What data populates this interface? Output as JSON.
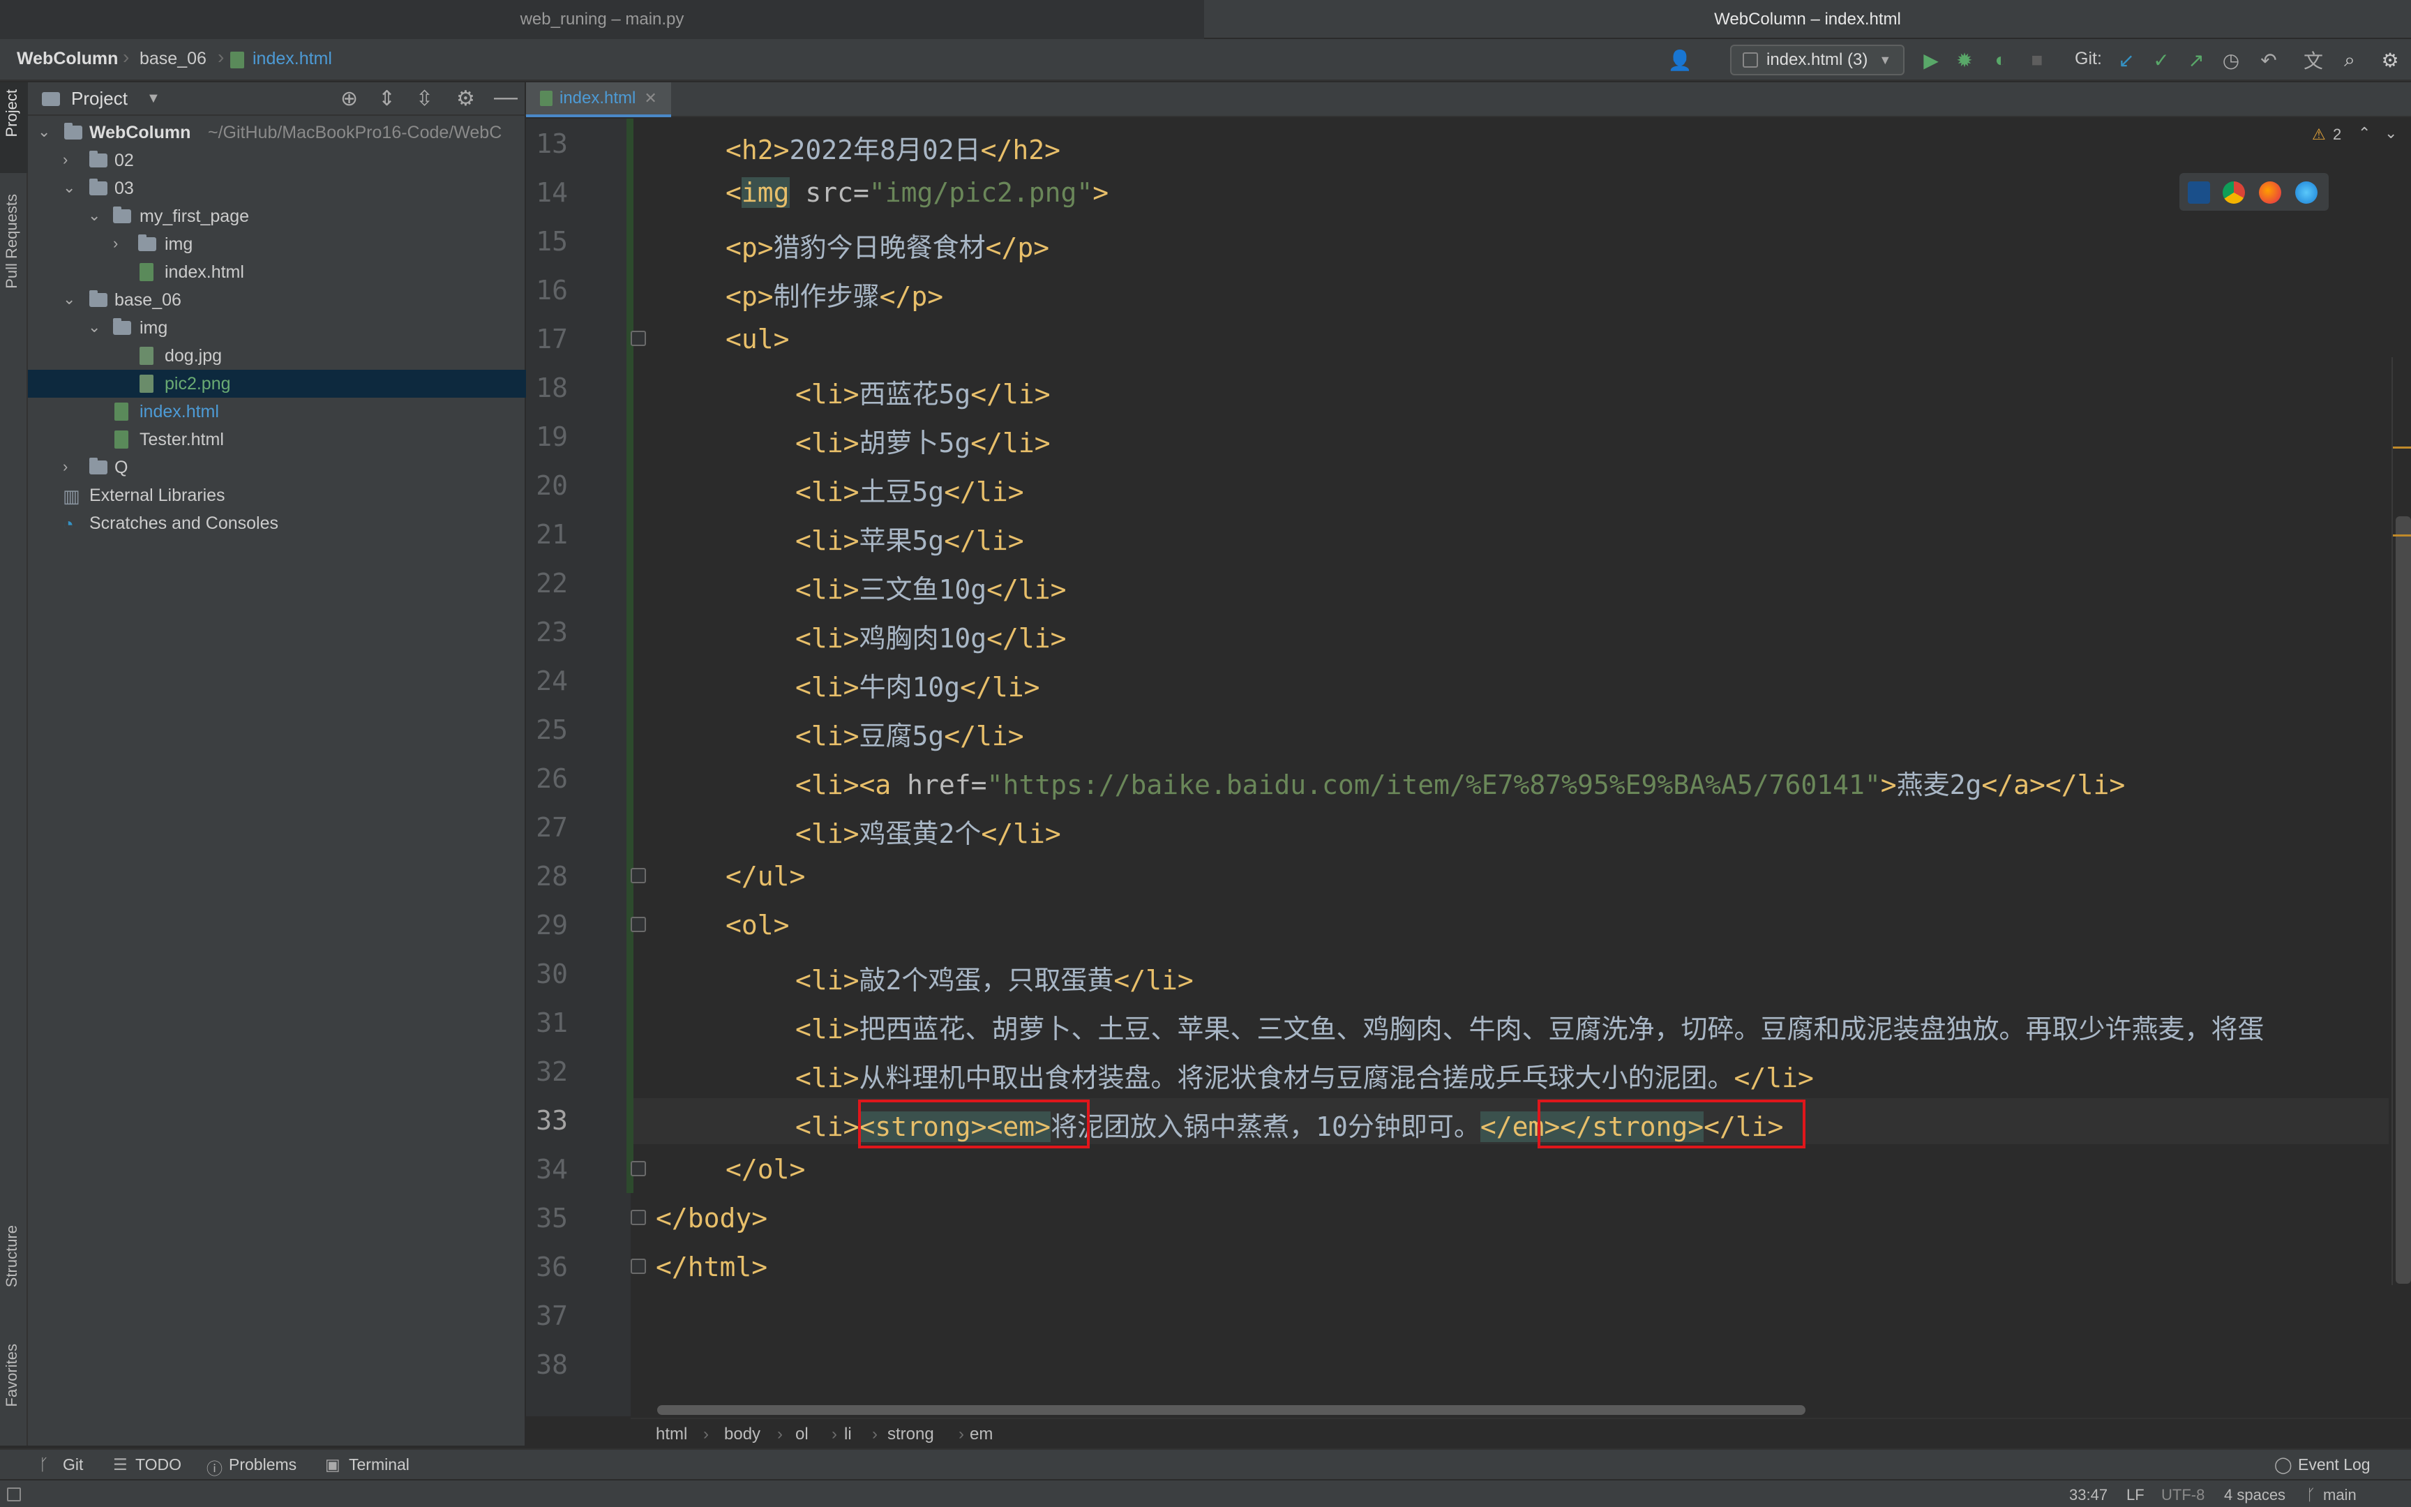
{
  "window": {
    "left_title": "web_runing – main.py",
    "right_title": "WebColumn – index.html"
  },
  "navbar": {
    "breadcrumbs": [
      "WebColumn",
      "base_06",
      "index.html"
    ],
    "run_config": "index.html (3)",
    "git_label": "Git:"
  },
  "left_strip": {
    "tabs": [
      "Project",
      "Pull Requests",
      "Structure",
      "Favorites"
    ]
  },
  "project": {
    "title": "Project",
    "tree": [
      {
        "label": "WebColumn",
        "extra": "~/GitHub/MacBookPro16-Code/WebC",
        "type": "root"
      },
      {
        "label": "02",
        "type": "folder"
      },
      {
        "label": "03",
        "type": "folder"
      },
      {
        "label": "my_first_page",
        "type": "folder"
      },
      {
        "label": "img",
        "type": "folder"
      },
      {
        "label": "index.html",
        "type": "file"
      },
      {
        "label": "base_06",
        "type": "folder"
      },
      {
        "label": "img",
        "type": "folder"
      },
      {
        "label": "dog.jpg",
        "type": "file"
      },
      {
        "label": "pic2.png",
        "type": "file"
      },
      {
        "label": "index.html",
        "type": "file"
      },
      {
        "label": "Tester.html",
        "type": "file"
      },
      {
        "label": "Q",
        "type": "folder"
      },
      {
        "label": "External Libraries",
        "type": "lib"
      },
      {
        "label": "Scratches and Consoles",
        "type": "scratch"
      }
    ]
  },
  "editor": {
    "tab": "index.html",
    "warnings": "2",
    "line_numbers": [
      "13",
      "14",
      "15",
      "16",
      "17",
      "18",
      "19",
      "20",
      "21",
      "22",
      "23",
      "24",
      "25",
      "26",
      "27",
      "28",
      "29",
      "30",
      "31",
      "32",
      "33",
      "34",
      "35",
      "36",
      "37",
      "38"
    ],
    "lines": {
      "l13": {
        "open": "<h2>",
        "text": "2022年8月02日",
        "close": "</h2>"
      },
      "l14": {
        "open": "<",
        "tagname": "img",
        "attr": " src=",
        "str": "\"img/pic2.png\"",
        "close": ">"
      },
      "l15": {
        "open": "<p>",
        "text": "猎豹今日晚餐食材",
        "close": "</p>"
      },
      "l16": {
        "open": "<p>",
        "text": "制作步骤",
        "close": "</p>"
      },
      "l17": {
        "open": "<ul>"
      },
      "l18": {
        "open": "<li>",
        "text": "西蓝花5g",
        "close": "</li>"
      },
      "l19": {
        "open": "<li>",
        "text": "胡萝卜5g",
        "close": "</li>"
      },
      "l20": {
        "open": "<li>",
        "text": "土豆5g",
        "close": "</li>"
      },
      "l21": {
        "open": "<li>",
        "text": "苹果5g",
        "close": "</li>"
      },
      "l22": {
        "open": "<li>",
        "text": "三文鱼10g",
        "close": "</li>"
      },
      "l23": {
        "open": "<li>",
        "text": "鸡胸肉10g",
        "close": "</li>"
      },
      "l24": {
        "open": "<li>",
        "text": "牛肉10g",
        "close": "</li>"
      },
      "l25": {
        "open": "<li>",
        "text": "豆腐5g",
        "close": "</li>"
      },
      "l26": {
        "open": "<li><a",
        "attr": " href=",
        "str": "\"https://baike.baidu.com/item/%E7%87%95%E9%BA%A5/760141\"",
        "gt": ">",
        "text": "燕麦2g",
        "close": "</a></li>"
      },
      "l27": {
        "open": "<li>",
        "text": "鸡蛋黄2个",
        "close": "</li>"
      },
      "l28": {
        "open": "</ul>"
      },
      "l29": {
        "open": "<ol>"
      },
      "l30": {
        "open": "<li>",
        "text": "敲2个鸡蛋，只取蛋黄",
        "close": "</li>"
      },
      "l31": {
        "open": "<li>",
        "text": "把西蓝花、胡萝卜、土豆、苹果、三文鱼、鸡胸肉、牛肉、豆腐洗净，切碎。豆腐和成泥装盘独放。再取少许燕麦，将蛋"
      },
      "l32": {
        "open": "<li>",
        "text": "从料理机中取出食材装盘。将泥状食材与豆腐混合搓成乒乓球大小的泥团。",
        "close": "</li>"
      },
      "l33": {
        "open": "<li>",
        "strong": "<strong>",
        "em": "<em>",
        "text": "将泥团放入锅中蒸煮，10分钟即可。",
        "em_close": "</em>",
        "strong_close": "</strong>",
        "close": "</li>"
      },
      "l34": {
        "open": "</ol>"
      },
      "l35": {
        "open": "</body>"
      },
      "l36": {
        "open": "</html>"
      }
    }
  },
  "breadcrumb_footer": [
    "html",
    "body",
    "ol",
    "li",
    "strong",
    "em"
  ],
  "toolwindows": {
    "git": "Git",
    "todo": "TODO",
    "problems": "Problems",
    "terminal": "Terminal",
    "event_log": "Event Log"
  },
  "status": {
    "position": "33:47",
    "line_sep": "LF",
    "encoding": "UTF-8",
    "indent": "4 spaces",
    "branch": "main"
  }
}
